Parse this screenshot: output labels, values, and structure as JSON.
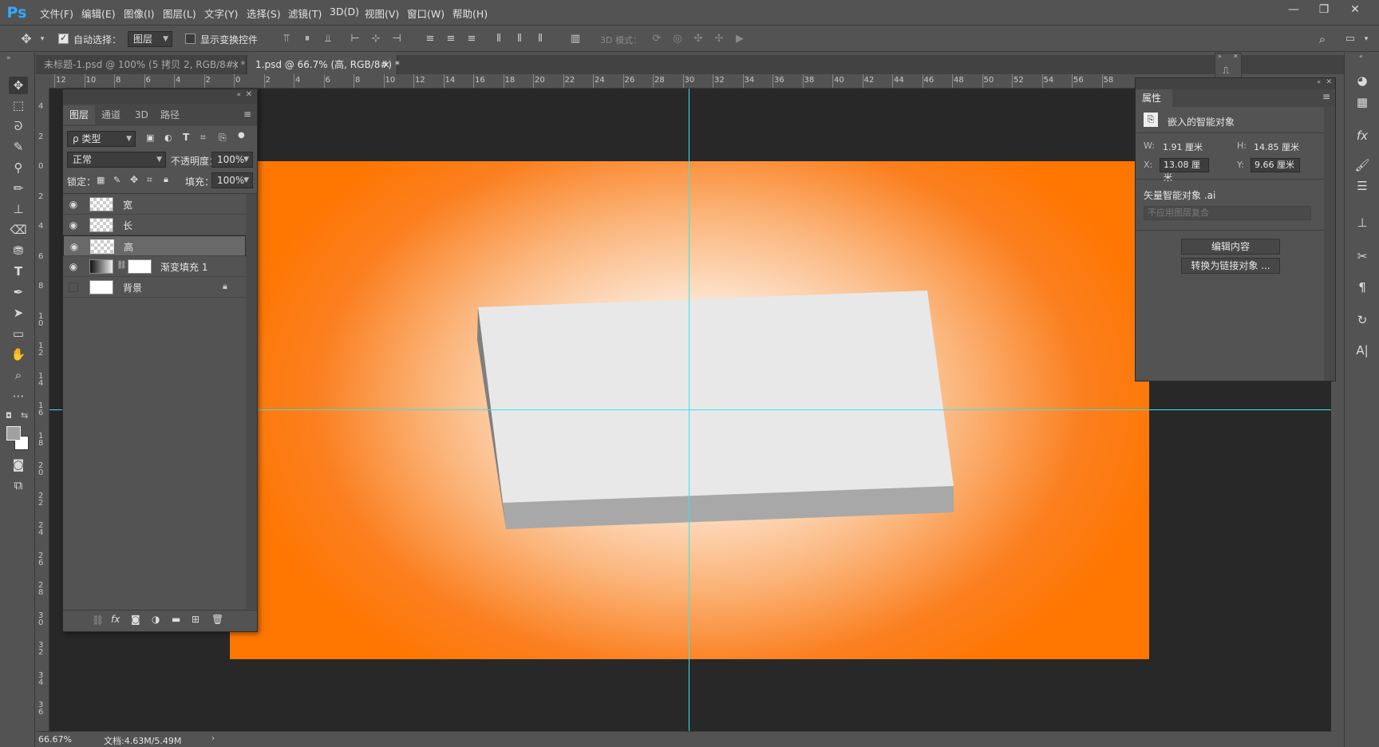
{
  "app": {
    "logo": "Ps"
  },
  "menu": [
    "文件(F)",
    "编辑(E)",
    "图像(I)",
    "图层(L)",
    "文字(Y)",
    "选择(S)",
    "滤镜(T)",
    "3D(D)",
    "视图(V)",
    "窗口(W)",
    "帮助(H)"
  ],
  "window_controls": {
    "minimize": "—",
    "restore": "❐",
    "close": "✕"
  },
  "options": {
    "auto_select_label": "自动选择：",
    "auto_select_value": "图层",
    "show_transform_label": "显示变换控件",
    "mode_3d_label": "3D 模式："
  },
  "tabs": [
    {
      "label": "未标题-1.psd @ 100% (5 拷贝 2, RGB/8#) *",
      "close": "×"
    },
    {
      "label": "1.psd @ 66.7% (高, RGB/8#) *",
      "close": "×"
    }
  ],
  "ruler_h": [
    "12",
    "10",
    "8",
    "6",
    "4",
    "2",
    "0",
    "2",
    "4",
    "6",
    "8",
    "10",
    "12",
    "14",
    "16",
    "18",
    "20",
    "22",
    "24",
    "26",
    "28",
    "30",
    "32",
    "34",
    "36",
    "38",
    "40",
    "42",
    "44",
    "46",
    "48",
    "50",
    "52",
    "54",
    "56",
    "58"
  ],
  "ruler_v": [
    "4",
    "2",
    "0",
    "2",
    "4",
    "6",
    "8",
    "10",
    "12",
    "14",
    "16",
    "18",
    "20",
    "22",
    "24",
    "26",
    "28",
    "30",
    "32",
    "34",
    "36"
  ],
  "layers_panel": {
    "tabs": [
      "图层",
      "通道",
      "3D",
      "路径"
    ],
    "filter_value": "ρ 类型",
    "blend_mode": "正常",
    "opacity_label": "不透明度：",
    "opacity_value": "100%",
    "lock_label": "锁定：",
    "fill_label": "填充：",
    "fill_value": "100%",
    "layers": [
      {
        "name": "宽",
        "visible": true,
        "selected": false
      },
      {
        "name": "长",
        "visible": true,
        "selected": false
      },
      {
        "name": "高",
        "visible": true,
        "selected": true
      },
      {
        "name": "渐变填充 1",
        "visible": true,
        "selected": false
      },
      {
        "name": "背景",
        "visible": false,
        "selected": false,
        "locked": true
      }
    ]
  },
  "properties": {
    "title": "属性",
    "type": "嵌入的智能对象",
    "w_label": "W:",
    "w_value": "1.91 厘米",
    "h_label": "H:",
    "h_value": "14.85 厘米",
    "x_label": "X:",
    "x_value": "13.08 厘米",
    "y_label": "Y:",
    "y_value": "9.66 厘米",
    "source": "矢量智能对象 .ai",
    "comp_placeholder": "不应用图层复合",
    "edit_button": "编辑内容",
    "convert_button": "转换为链接对象 ..."
  },
  "status": {
    "zoom": "66.67%",
    "doc": "文档:4.63M/5.49M"
  },
  "colors": {
    "canvas_edge": "#ff7600",
    "canvas_center": "#ffffff",
    "guide": "#35e6f0"
  }
}
